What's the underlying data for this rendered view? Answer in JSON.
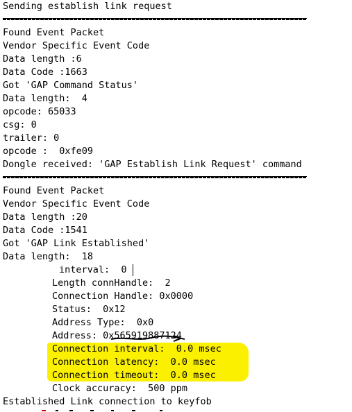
{
  "lines": {
    "l00": "Sending establish link request",
    "l01": "Found Event Packet",
    "l02": "Vendor Specific Event Code",
    "l03": "Data length :6",
    "l04": "Data Code :1663",
    "l05": "Got 'GAP Command Status'",
    "l06": "Data length:  4",
    "l07": "opcode: 65033",
    "l08": "csg: 0",
    "l09": "trailer: 0",
    "l10": "opcode :  0xfe09",
    "l11": "Dongle received: 'GAP Establish Link Request' command",
    "l12": "Found Event Packet",
    "l13": "Vendor Specific Event Code",
    "l14": "Data length :20",
    "l15": "Data Code :1541",
    "l16": "Got 'GAP Link Established'",
    "l17": "Data length:  18",
    "l18": "interval:  0",
    "l19": "Length connHandle:  2",
    "l20": "Connection Handle: 0x0000",
    "l21": "Status:  0x12",
    "l22": "Address Type:  0x0",
    "l23": "Address: 0x565919887124",
    "l24": "Connection interval:  0.0 msec",
    "l25": "Connection latency:  0.0 msec",
    "l26": "Connection timeout:  0.0 msec",
    "l27": "Clock accuracy:  500 ppm",
    "l28": "Established Link connection to keyfob"
  },
  "colors": {
    "highlight": "#fbf000",
    "text": "#000000",
    "annotation_red": "#cc0000"
  }
}
